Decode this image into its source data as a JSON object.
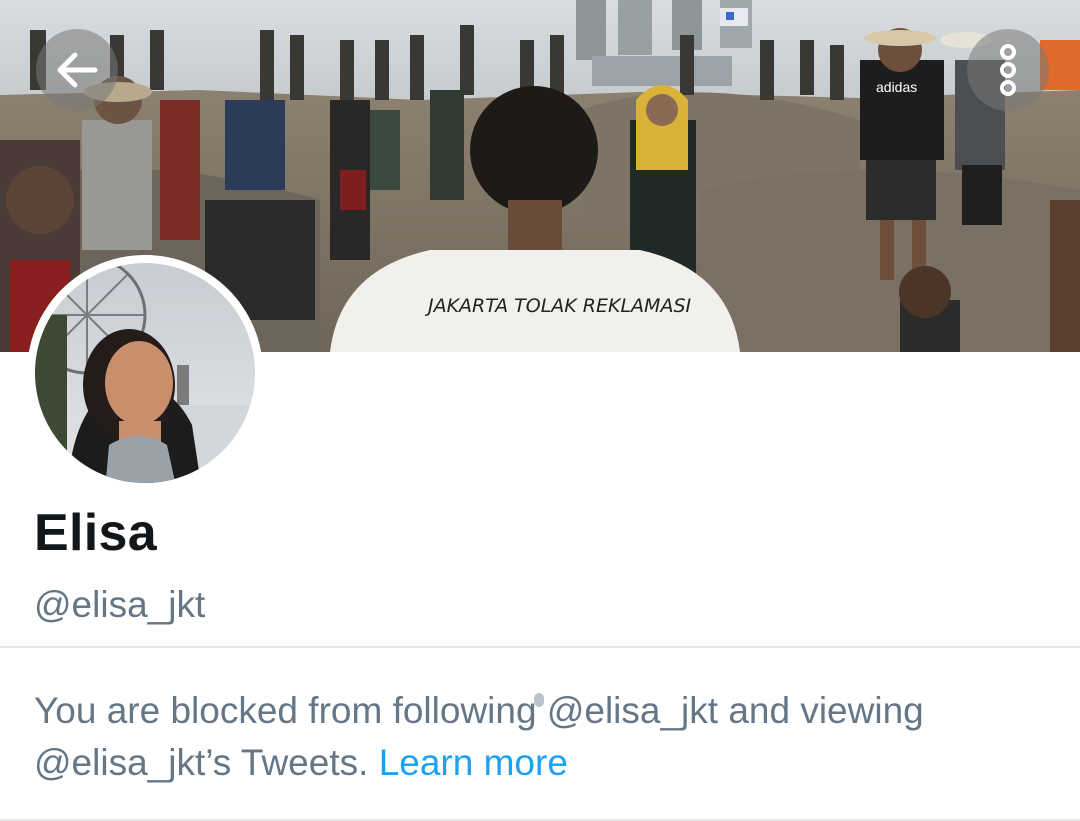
{
  "header": {
    "banner_shirt_text": "JAKARTA TOLAK REKLAMASI",
    "banner_jacket_text": "adidas"
  },
  "profile": {
    "display_name": "Elisa",
    "handle": "@elisa_jkt"
  },
  "blocked_notice": {
    "message": "You are blocked from following @elisa_jkt and viewing @elisa_jkt’s Tweets.",
    "learn_more_label": "Learn more"
  },
  "icons": {
    "back": "arrow-left-icon",
    "more": "more-vertical-icon"
  },
  "colors": {
    "link": "#1da1f2",
    "secondary_text": "#657786",
    "primary_text": "#14171a",
    "divider": "#e1e8ed"
  }
}
